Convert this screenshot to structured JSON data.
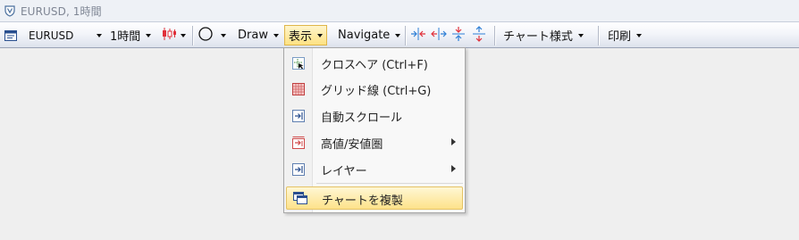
{
  "window": {
    "title": "EURUSD, 1時間"
  },
  "toolbar": {
    "symbol": "EURUSD",
    "timeframe": "1時間",
    "draw": "Draw",
    "view": "表示",
    "navigate": "Navigate",
    "chart_style": "チャート様式",
    "print": "印刷"
  },
  "menu": {
    "items": [
      {
        "label": "クロスヘア (Ctrl+F)",
        "icon": "crosshair-icon"
      },
      {
        "label": "グリッド線 (Ctrl+G)",
        "icon": "grid-icon"
      },
      {
        "label": "自動スクロール",
        "icon": "auto-scroll-icon"
      },
      {
        "label": "高値/安値圏",
        "icon": "high-low-icon",
        "submenu": true
      },
      {
        "label": "レイヤー",
        "icon": "layers-icon",
        "submenu": true
      },
      {
        "label": "チャートを複製",
        "icon": "duplicate-chart-icon",
        "highlighted": true
      }
    ]
  },
  "colors": {
    "accent_highlight": "#fde28a",
    "chart_red": "#e0303a",
    "navigate_blue": "#2f7fd6"
  }
}
